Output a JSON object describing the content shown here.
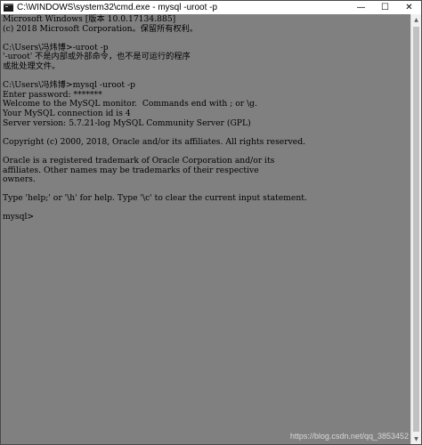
{
  "window": {
    "title": "C:\\WINDOWS\\system32\\cmd.exe - mysql  -uroot -p",
    "minimize_glyph": "—",
    "maximize_glyph": "☐",
    "close_glyph": "✕"
  },
  "console": {
    "lines": [
      "Microsoft Windows [版本 10.0.17134.885]",
      "(c) 2018 Microsoft Corporation。保留所有权利。",
      "",
      "C:\\Users\\冯炜博>-uroot -p",
      "'-uroot' 不是内部或外部命令，也不是可运行的程序",
      "或批处理文件。",
      "",
      "C:\\Users\\冯炜博>mysql -uroot -p",
      "Enter password: *******",
      "Welcome to the MySQL monitor.  Commands end with ; or \\g.",
      "Your MySQL connection id is 4",
      "Server version: 5.7.21-log MySQL Community Server (GPL)",
      "",
      "Copyright (c) 2000, 2018, Oracle and/or its affiliates. All rights reserved.",
      "",
      "Oracle is a registered trademark of Oracle Corporation and/or its",
      "affiliates. Other names may be trademarks of their respective",
      "owners.",
      "",
      "Type 'help;' or '\\h' for help. Type '\\c' to clear the current input statement.",
      "",
      "mysql>"
    ]
  },
  "scrollbar": {
    "up_glyph": "▲",
    "down_glyph": "▼"
  },
  "watermark": "https://blog.csdn.net/qq_3853452"
}
